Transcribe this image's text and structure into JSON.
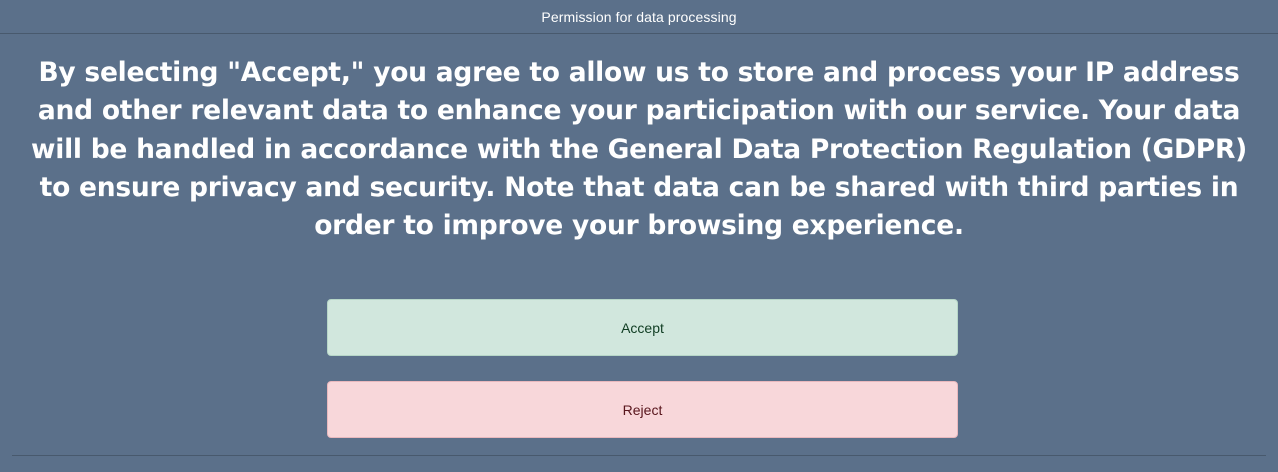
{
  "dialog": {
    "title": "Permission for data processing",
    "message": "By selecting \"Accept,\" you agree to allow us to store and process your IP address and other relevant data to enhance your participation with our service. Your data will be handled in accordance with the General Data Protection Regulation (GDPR) to ensure privacy and security. Note that data can be shared with third parties in order to improve your browsing experience.",
    "accept_label": "Accept",
    "reject_label": "Reject"
  },
  "colors": {
    "background": "#5b708a",
    "accept_button": "#d1e7dd",
    "reject_button": "#f8d7da",
    "text": "#ffffff"
  }
}
